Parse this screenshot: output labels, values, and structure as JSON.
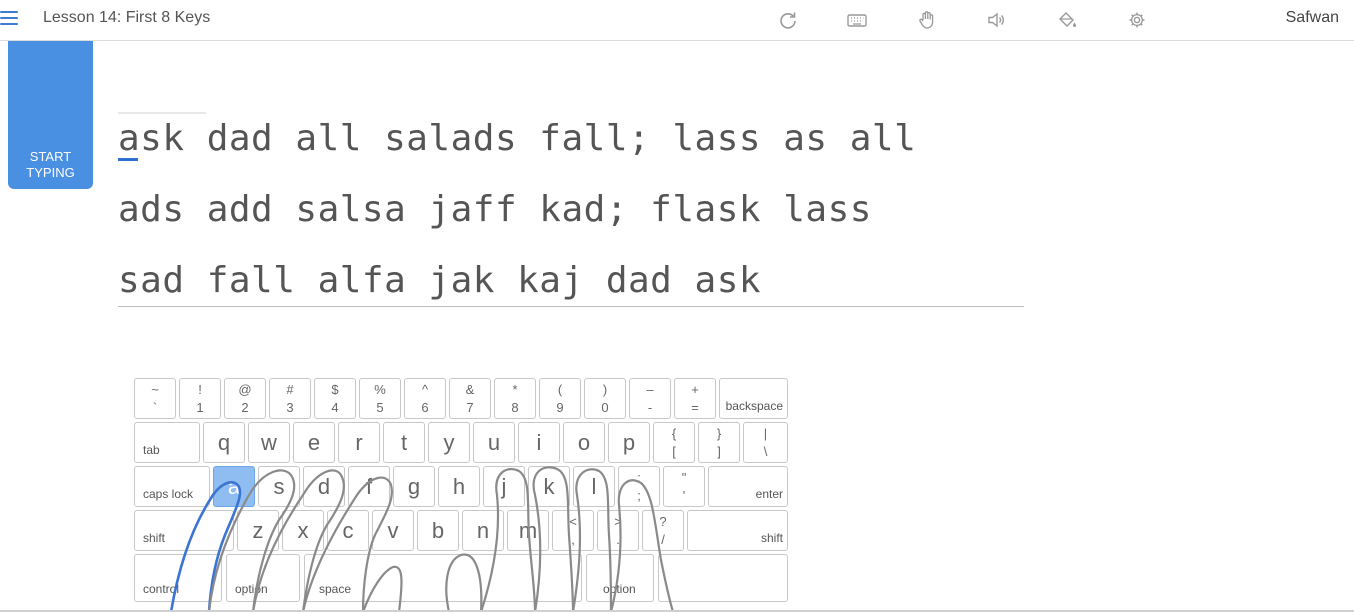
{
  "header": {
    "lesson_title": "Lesson 14: First 8 Keys",
    "user_name": "Safwan",
    "tools": [
      "restart-icon",
      "keyboard-icon",
      "hand-icon",
      "sound-icon",
      "paint-bucket-icon",
      "settings-icon"
    ]
  },
  "start_button": {
    "label": "START\nTYPING"
  },
  "lesson_text": {
    "lines": [
      "ask dad all salads fall; lass as all",
      "ads add salsa jaff kad; flask lass",
      "sad fall alfa jak kaj dad ask"
    ]
  },
  "keyboard": {
    "accent": "#8fbdf2",
    "active_key": "a",
    "number_row": [
      {
        "up": "~",
        "down": "`"
      },
      {
        "up": "!",
        "down": "1"
      },
      {
        "up": "@",
        "down": "2"
      },
      {
        "up": "#",
        "down": "3"
      },
      {
        "up": "$",
        "down": "4"
      },
      {
        "up": "%",
        "down": "5"
      },
      {
        "up": "^",
        "down": "6"
      },
      {
        "up": "&",
        "down": "7"
      },
      {
        "up": "*",
        "down": "8"
      },
      {
        "up": "(",
        "down": "9"
      },
      {
        "up": ")",
        "down": "0"
      },
      {
        "up": "–",
        "down": "-"
      },
      {
        "up": "+",
        "down": "="
      }
    ],
    "backspace": "backspace",
    "tab": "tab",
    "top_row": [
      "q",
      "w",
      "e",
      "r",
      "t",
      "y",
      "u",
      "i",
      "o",
      "p"
    ],
    "top_row_pairs": [
      {
        "up": "{",
        "down": "["
      },
      {
        "up": "}",
        "down": "]"
      },
      {
        "up": "|",
        "down": "\\"
      }
    ],
    "caps_lock": "caps lock",
    "home_row": [
      "a",
      "s",
      "d",
      "f",
      "g",
      "h",
      "j",
      "k",
      "l"
    ],
    "home_row_pairs": [
      {
        "up": ":",
        "down": ";"
      },
      {
        "up": "\"",
        "down": "'"
      }
    ],
    "enter": "enter",
    "shift_left": "shift",
    "bottom_row": [
      "z",
      "x",
      "c",
      "v",
      "b",
      "n",
      "m"
    ],
    "bottom_row_pairs": [
      {
        "up": "<",
        "down": ","
      },
      {
        "up": ">",
        "down": "."
      },
      {
        "up": "?",
        "down": "/"
      }
    ],
    "shift_right": "shift",
    "control": "control",
    "option_left": "option",
    "space": "space",
    "option_right": "option"
  }
}
